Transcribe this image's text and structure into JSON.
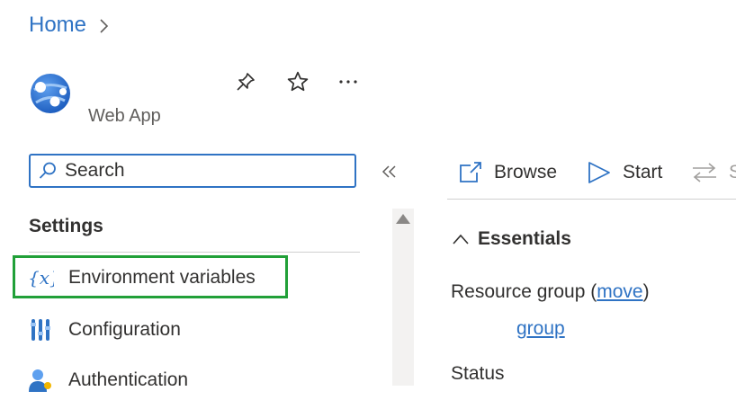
{
  "breadcrumb": {
    "home_label": "Home"
  },
  "resource": {
    "type_label": "Web App"
  },
  "search": {
    "placeholder": "Search"
  },
  "sidebar": {
    "section_title": "Settings",
    "items": [
      {
        "label": "Environment variables",
        "icon": "variable-icon"
      },
      {
        "label": "Configuration",
        "icon": "configuration-icon"
      },
      {
        "label": "Authentication",
        "icon": "authentication-icon"
      }
    ]
  },
  "toolbar": {
    "browse_label": "Browse",
    "start_label": "Start",
    "swap_partial_label": "S"
  },
  "essentials": {
    "title": "Essentials",
    "resource_group_label": "Resource group (",
    "move_link": "move",
    "close_paren": ")",
    "resource_group_value": "group",
    "status_label": "Status"
  },
  "colors": {
    "accent": "#2f73c4",
    "highlight": "#21a038"
  }
}
